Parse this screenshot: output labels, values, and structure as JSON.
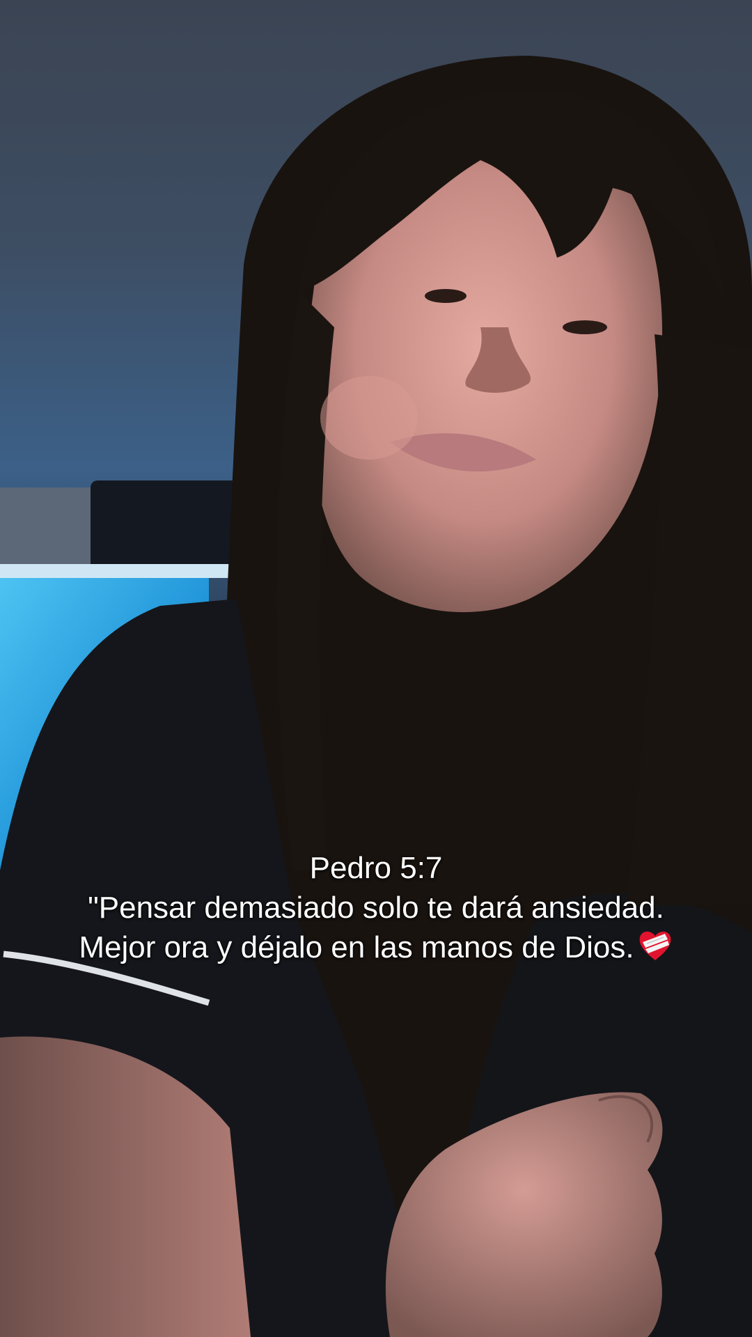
{
  "scene": {
    "description_icon": "video-frame",
    "colors": {
      "wall_top": "#3a4554",
      "wall_mid": "#3f5f84",
      "monitor_glow": "#2fa6e0",
      "shirt": "#15161a",
      "hair": "#1a1512",
      "skin": "#c98e86"
    }
  },
  "caption": {
    "reference": "Pedro 5:7",
    "line1": "\"Pensar demasiado solo te dará ansiedad.",
    "line2": "Mejor ora y déjalo en las manos de Dios.",
    "emoji_icon": "bandaged-heart-icon"
  }
}
